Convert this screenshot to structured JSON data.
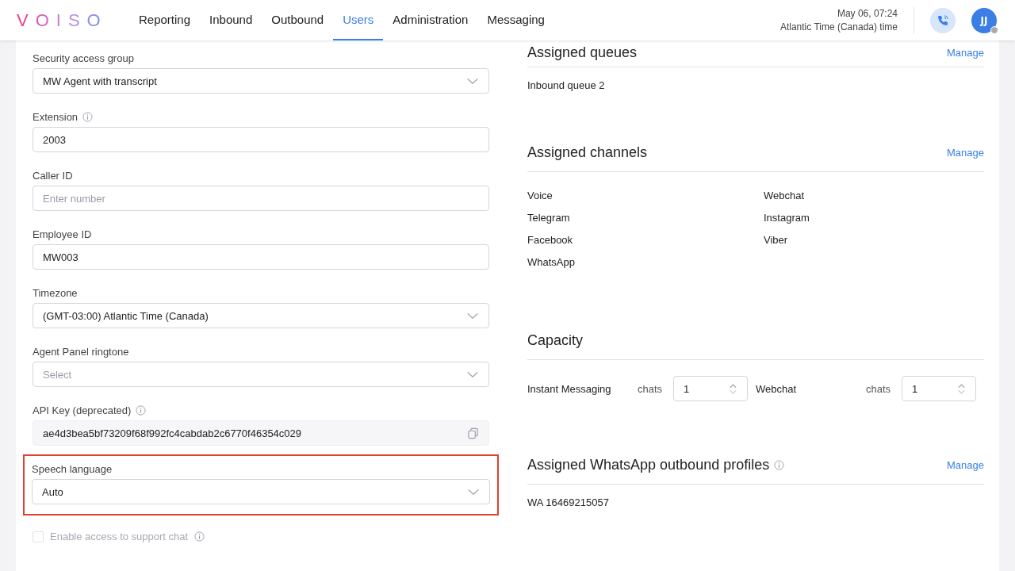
{
  "header": {
    "logo": "VOISO",
    "nav": [
      {
        "label": "Reporting",
        "selected": false
      },
      {
        "label": "Inbound",
        "selected": false
      },
      {
        "label": "Outbound",
        "selected": false
      },
      {
        "label": "Users",
        "selected": true
      },
      {
        "label": "Administration",
        "selected": false
      },
      {
        "label": "Messaging",
        "selected": false
      }
    ],
    "datetime": "May 06, 07:24",
    "timezone": "Atlantic Time (Canada) time",
    "avatar": "JJ"
  },
  "fields": [
    {
      "kind": "select",
      "label": "Security access group",
      "value": "MW Agent with transcript",
      "info": false,
      "highlighted": false
    },
    {
      "kind": "text",
      "label": "Extension",
      "value": "2003",
      "info": true,
      "highlighted": false
    },
    {
      "kind": "text",
      "label": "Caller ID",
      "placeholder": "Enter number",
      "info": false,
      "highlighted": false
    },
    {
      "kind": "text",
      "label": "Employee ID",
      "value": "MW003",
      "info": false,
      "highlighted": false
    },
    {
      "kind": "select",
      "label": "Timezone",
      "value": "(GMT-03:00) Atlantic Time (Canada)",
      "info": false,
      "highlighted": false
    },
    {
      "kind": "select",
      "label": "Agent Panel ringtone",
      "placeholder": "Select",
      "info": false,
      "highlighted": false
    },
    {
      "kind": "readonly",
      "label": "API Key (deprecated)",
      "value": "ae4d3bea5bf73209f68f992fc4cabdab2c6770f46354c029",
      "info": true,
      "highlighted": false
    },
    {
      "kind": "select",
      "label": "Speech language",
      "value": "Auto",
      "info": false,
      "highlighted": true
    }
  ],
  "support_chat": {
    "label": "Enable access to support chat",
    "checked": false,
    "disabled": true
  },
  "sections": [
    {
      "kind": "list",
      "title": "Assigned queues",
      "info": false,
      "action": "Manage",
      "items": [
        "Inbound queue 2"
      ]
    },
    {
      "kind": "grid",
      "title": "Assigned channels",
      "info": false,
      "action": "Manage",
      "items": [
        "Voice",
        "Webchat",
        "Telegram",
        "Instagram",
        "Facebook",
        "Viber",
        "WhatsApp"
      ]
    },
    {
      "kind": "capacity",
      "title": "Capacity",
      "info": false,
      "rows": [
        {
          "name": "Instant Messaging",
          "unit": "chats",
          "value": "1"
        },
        {
          "name": "Webchat",
          "unit": "chats",
          "value": "1"
        }
      ]
    },
    {
      "kind": "list",
      "title": "Assigned WhatsApp outbound profiles",
      "info": true,
      "action": "Manage",
      "items": [
        "WA 16469215057"
      ]
    }
  ]
}
